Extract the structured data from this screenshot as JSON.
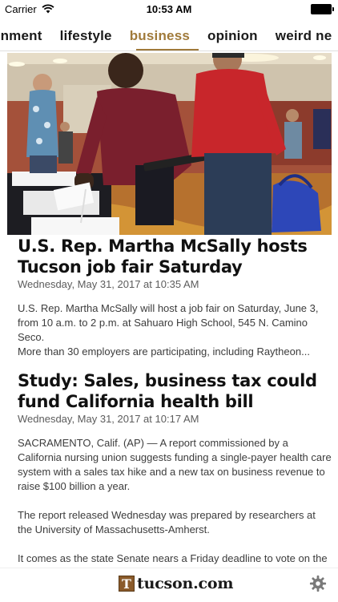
{
  "status_bar": {
    "carrier": "Carrier",
    "time": "10:53 AM"
  },
  "tabs": [
    {
      "label": "ainment",
      "active": false
    },
    {
      "label": "lifestyle",
      "active": false
    },
    {
      "label": "business",
      "active": true
    },
    {
      "label": "opinion",
      "active": false
    },
    {
      "label": "weird ne",
      "active": false
    }
  ],
  "accent_color": "#a07a3a",
  "articles": [
    {
      "headline": "U.S. Rep. Martha McSally hosts Tucson job fair Saturday",
      "date": "Wednesday, May 31, 2017 at 10:35 AM",
      "paragraphs": [
        "U.S. Rep. Martha McSally will host a job fair on Saturday, June 3, from 10 a.m. to 2 p.m. at Sahuaro High School, 545 N. Camino Seco.",
        "More than 30 employers are participating, including Raytheon..."
      ]
    },
    {
      "headline": "Study: Sales, business tax could fund California health bill",
      "date": "Wednesday, May 31, 2017 at 10:17 AM",
      "paragraphs": [
        "SACRAMENTO, Calif. (AP) — A report commissioned by a California nursing union suggests funding a single-payer health care system with a sales tax hike and a new tax on business revenue to raise $100 billion a year.",
        "The report released Wednesday was prepared by researchers at the University of Massachusetts-Amherst.",
        "It comes as the state Senate nears a Friday deadline to vote on the bill to eliminate health insurance companies and provide"
      ]
    }
  ],
  "bottom_bar": {
    "logo_mark": "T",
    "logo_text": "tucson.com",
    "settings_icon": "gear-icon"
  }
}
